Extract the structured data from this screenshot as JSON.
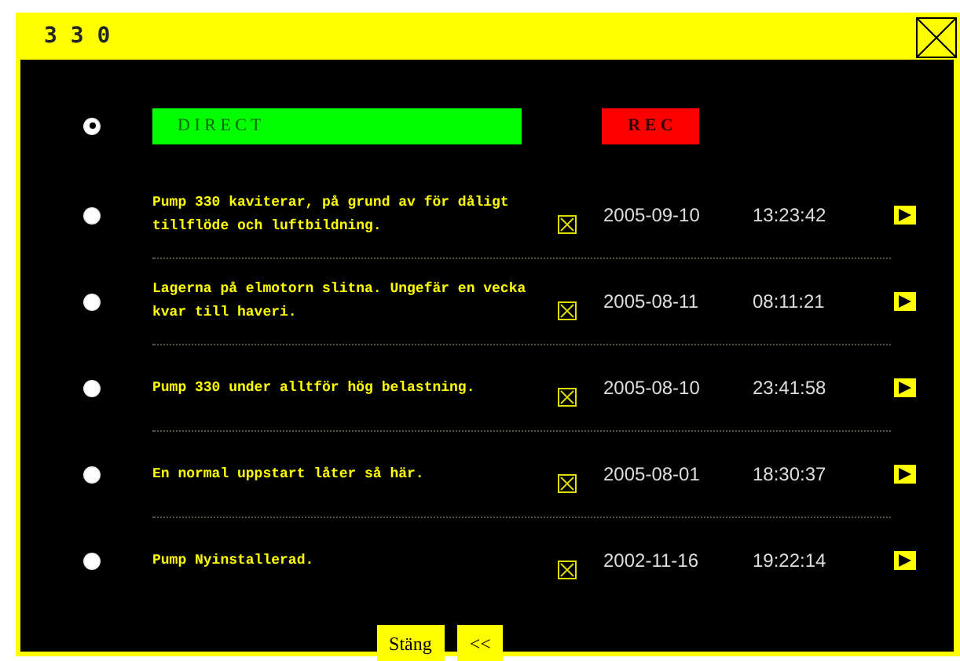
{
  "window": {
    "title": "3 3 0"
  },
  "source": {
    "selected": true,
    "direct_label": "D I R E C T",
    "rec_label": "R E C"
  },
  "recordings": [
    {
      "selected": false,
      "description": "Pump 330 kaviterar, på grund av för dåligt tillflöde och luftbildning.",
      "date": "2005-09-10",
      "time": "13:23:42"
    },
    {
      "selected": false,
      "description": "Lagerna på elmotorn slitna. Ungefär en vecka kvar till haveri.",
      "date": "2005-08-11",
      "time": "08:11:21"
    },
    {
      "selected": false,
      "description": "Pump 330 under alltför hög belastning.",
      "date": "2005-08-10",
      "time": "23:41:58"
    },
    {
      "selected": false,
      "description": "En normal uppstart låter så här.",
      "date": "2005-08-01",
      "time": "18:30:37"
    },
    {
      "selected": false,
      "description": "Pump Nyinstallerad.",
      "date": "2002-11-16",
      "time": "19:22:14"
    }
  ],
  "buttons": [
    "Stäng",
    "<<"
  ]
}
